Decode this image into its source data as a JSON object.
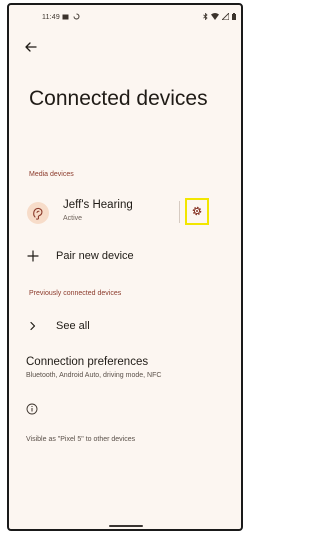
{
  "status_bar": {
    "time": "11:49"
  },
  "page": {
    "title": "Connected devices"
  },
  "media_devices": {
    "header": "Media devices",
    "device": {
      "name": "Jeff's Hearing",
      "status": "Active",
      "icon": "ear-icon"
    }
  },
  "pair_new_device": {
    "label": "Pair new device",
    "icon": "plus-icon"
  },
  "previously_connected": {
    "header": "Previously connected devices",
    "see_all_label": "See all",
    "icon": "chevron-right-icon"
  },
  "connection_preferences": {
    "title": "Connection preferences",
    "subtitle": "Bluetooth, Android Auto, driving mode, NFC"
  },
  "footer": {
    "visible_as": "Visible as \"Pixel 5\" to other devices",
    "icon": "info-icon"
  },
  "colors": {
    "background": "#fcf6f1",
    "accent": "#8b3a2b",
    "highlight": "#f2e600",
    "avatar_bg": "#f7dcc9"
  }
}
